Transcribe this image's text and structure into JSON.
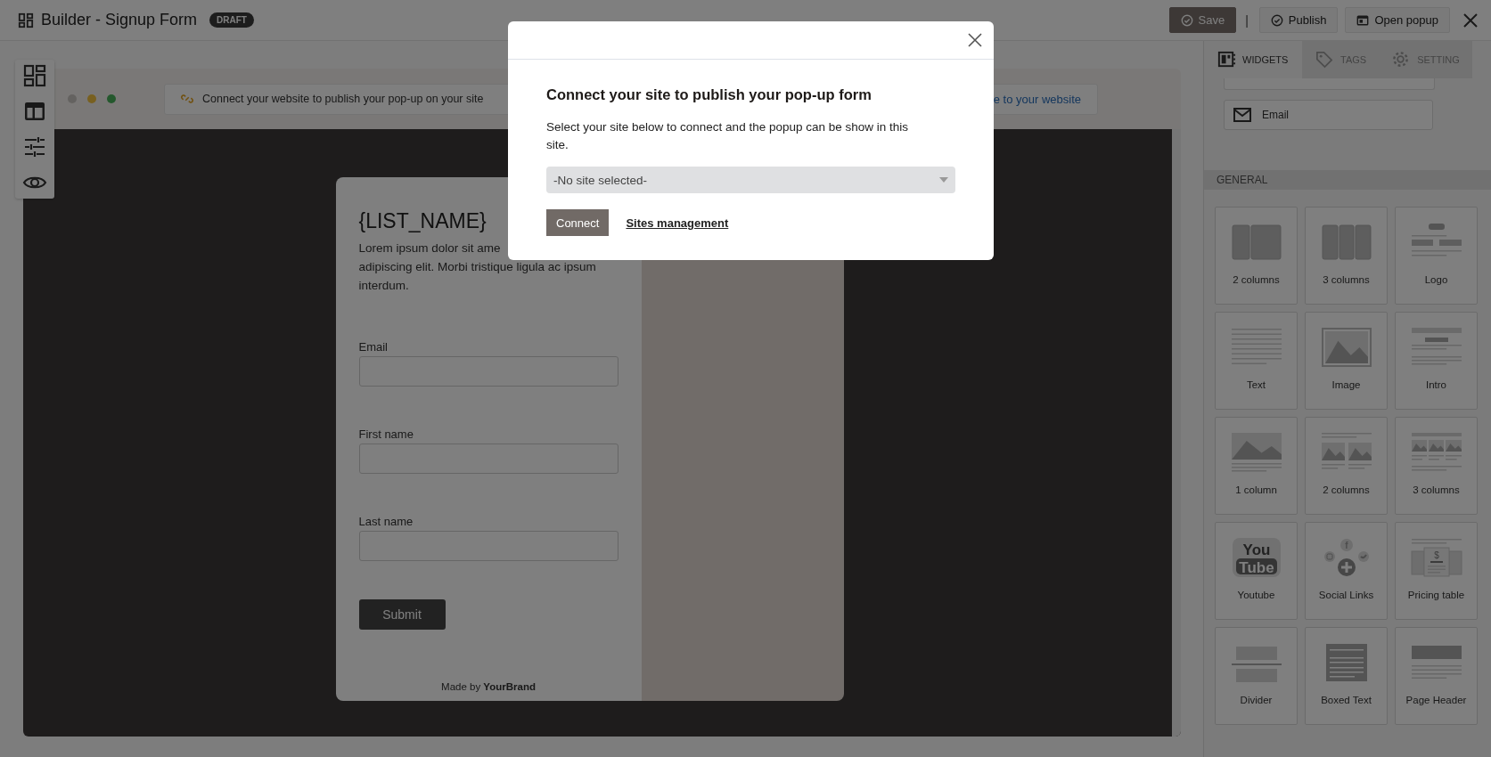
{
  "header": {
    "title": "Builder - Signup Form",
    "badge": "DRAFT",
    "separator": "|",
    "buttons": [
      {
        "label": "Save",
        "kind": "primary"
      },
      {
        "label": "Publish",
        "kind": "publish"
      },
      {
        "label": "Open popup",
        "kind": "popup"
      }
    ]
  },
  "preview": {
    "url_bar": {
      "message": "Connect your website to publish your pop-up on your site",
      "link": "e to your website"
    },
    "form": {
      "title": "{LIST_NAME}",
      "intro_first_line": "Lorem ipsum dolor sit ame",
      "intro_rest": "adipiscing elit. Morbi tristique ligula ac ipsum interdum.",
      "fields": [
        {
          "label": "Email"
        },
        {
          "label": "First name"
        },
        {
          "label": "Last name"
        }
      ],
      "submit": "Submit",
      "footer": "Made by **YourBrand**"
    }
  },
  "sidebar": {
    "tabs": [
      {
        "label": "WIDGETS",
        "selected": true
      },
      {
        "label": "TAGS",
        "selected": false
      },
      {
        "label": "SETTING",
        "selected": false
      }
    ],
    "field_items": [
      {
        "label": "Email"
      }
    ],
    "section": "GENERAL",
    "widgets": [
      {
        "label": "2 columns"
      },
      {
        "label": "3 columns"
      },
      {
        "label": "Logo"
      },
      {
        "label": "Text"
      },
      {
        "label": "Image"
      },
      {
        "label": "Intro"
      },
      {
        "label": "1 column"
      },
      {
        "label": "2 columns"
      },
      {
        "label": "3 columns"
      },
      {
        "label": "Youtube",
        "icon_text": [
          "You",
          "Tube"
        ]
      },
      {
        "label": "Social Links",
        "icon_text": [
          "f"
        ]
      },
      {
        "label": "Pricing table",
        "icon_text": [
          "$"
        ]
      },
      {
        "label": "Divider"
      },
      {
        "label": "Boxed Text"
      },
      {
        "label": "Page Header"
      }
    ]
  },
  "modal": {
    "title": "Connect your site to publish your pop-up form",
    "text": "Select your site below to connect and the popup can be show in this site.",
    "select": {
      "value": "-No site selected-"
    },
    "connect": "Connect",
    "link": "Sites management"
  }
}
